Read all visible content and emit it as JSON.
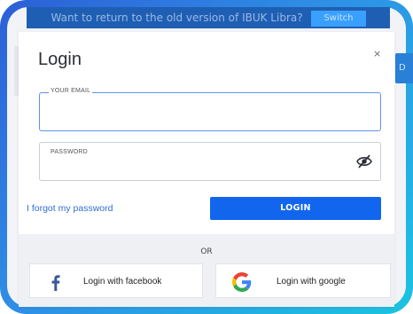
{
  "background": {
    "banner_text": "Want to return to the old version of IBUK Libra?",
    "banner_button": "Switch",
    "side_tab_text": "D"
  },
  "modal": {
    "title": "Login",
    "close_symbol": "×",
    "email": {
      "label": "YOUR EMAIL",
      "value": "",
      "placeholder": ""
    },
    "password": {
      "label": "PASSWORD",
      "value": "",
      "placeholder": "",
      "toggle_icon": "eye-slash-icon"
    },
    "forgot_link": "I forgot my password",
    "login_button": "LOGIN",
    "divider": "OR",
    "social": {
      "facebook_label": "Login with facebook",
      "google_label": "Login with google"
    }
  },
  "colors": {
    "primary": "#1266ee",
    "link": "#2f6fd1",
    "facebook": "#3b5998",
    "google_blue": "#4285F4",
    "google_red": "#EA4335",
    "google_yellow": "#FBBC05",
    "google_green": "#34A853",
    "frame_start": "#2c5fd7",
    "frame_end": "#1cc3e0"
  }
}
